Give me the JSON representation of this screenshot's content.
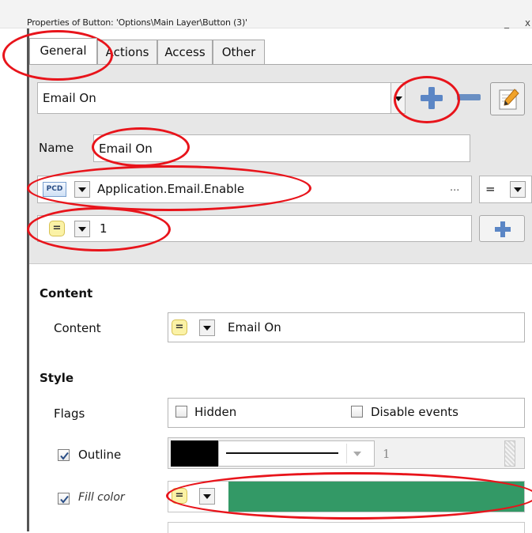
{
  "window": {
    "title": "Properties of Button: 'Options\\Main Layer\\Button (3)'",
    "minimize_glyph": "_",
    "close_glyph": "x"
  },
  "tabs": [
    {
      "label": "General",
      "active": true
    },
    {
      "label": "Actions",
      "active": false
    },
    {
      "label": "Access",
      "active": false
    },
    {
      "label": "Other",
      "active": false
    }
  ],
  "state": {
    "selected": "Email On",
    "name_label": "Name",
    "name_value": "Email On",
    "expression_badge": "PCD",
    "expression": "Application.Email.Enable",
    "expression_more": "...",
    "operator": "=",
    "compare_value": "1"
  },
  "content_section": {
    "heading": "Content",
    "label": "Content",
    "value": "Email On"
  },
  "style_section": {
    "heading": "Style",
    "flags_label": "Flags",
    "hidden_label": "Hidden",
    "disable_events_label": "Disable events",
    "outline_label": "Outline",
    "outline_checked": true,
    "outline_color": "#000000",
    "outline_width": "1",
    "fill_label": "Fill color",
    "fill_checked": true,
    "fill_color": "#339966"
  },
  "icons": {
    "add": "plus-icon",
    "remove": "minus-icon",
    "edit": "pencil-icon",
    "dropdown": "chevron-down-icon",
    "equals": "equals-icon"
  },
  "annotation_color": "#e8141b"
}
